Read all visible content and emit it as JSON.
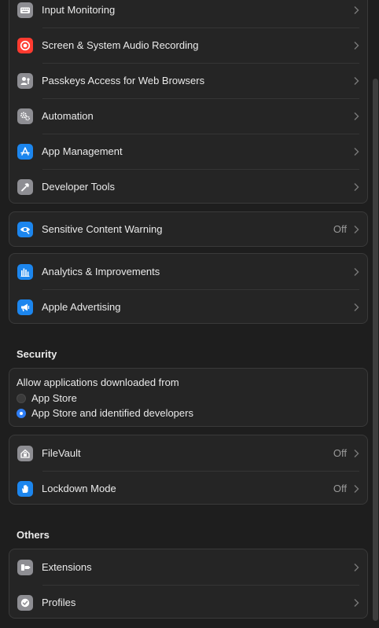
{
  "groups": {
    "privacy": [
      {
        "label": "Input Monitoring",
        "icon": "keyboard-icon",
        "color": "#8e8e93"
      },
      {
        "label": "Screen & System Audio Recording",
        "icon": "record-icon",
        "color": "#ff3b30"
      },
      {
        "label": "Passkeys Access for Web Browsers",
        "icon": "person-key-icon",
        "color": "#8e8e93"
      },
      {
        "label": "Automation",
        "icon": "gears-icon",
        "color": "#8e8e93"
      },
      {
        "label": "App Management",
        "icon": "app-store-icon",
        "color": "#1c86ee"
      },
      {
        "label": "Developer Tools",
        "icon": "hammer-icon",
        "color": "#8e8e93"
      }
    ],
    "sensitive": [
      {
        "label": "Sensitive Content Warning",
        "value": "Off",
        "icon": "eye-icon",
        "color": "#1c86ee"
      }
    ],
    "analytics": [
      {
        "label": "Analytics & Improvements",
        "icon": "bars-icon",
        "color": "#1c86ee"
      },
      {
        "label": "Apple Advertising",
        "icon": "megaphone-icon",
        "color": "#1c86ee"
      }
    ]
  },
  "security": {
    "title": "Security",
    "allow_label": "Allow applications downloaded from",
    "options": [
      {
        "label": "App Store",
        "selected": false
      },
      {
        "label": "App Store and identified developers",
        "selected": true
      }
    ],
    "rows": [
      {
        "label": "FileVault",
        "value": "Off",
        "icon": "house-lock-icon",
        "color": "#8e8e93"
      },
      {
        "label": "Lockdown Mode",
        "value": "Off",
        "icon": "hand-icon",
        "color": "#1c86ee"
      }
    ]
  },
  "others": {
    "title": "Others",
    "rows": [
      {
        "label": "Extensions",
        "icon": "puzzle-icon",
        "color": "#8e8e93"
      },
      {
        "label": "Profiles",
        "icon": "check-badge-icon",
        "color": "#8e8e93"
      }
    ]
  }
}
